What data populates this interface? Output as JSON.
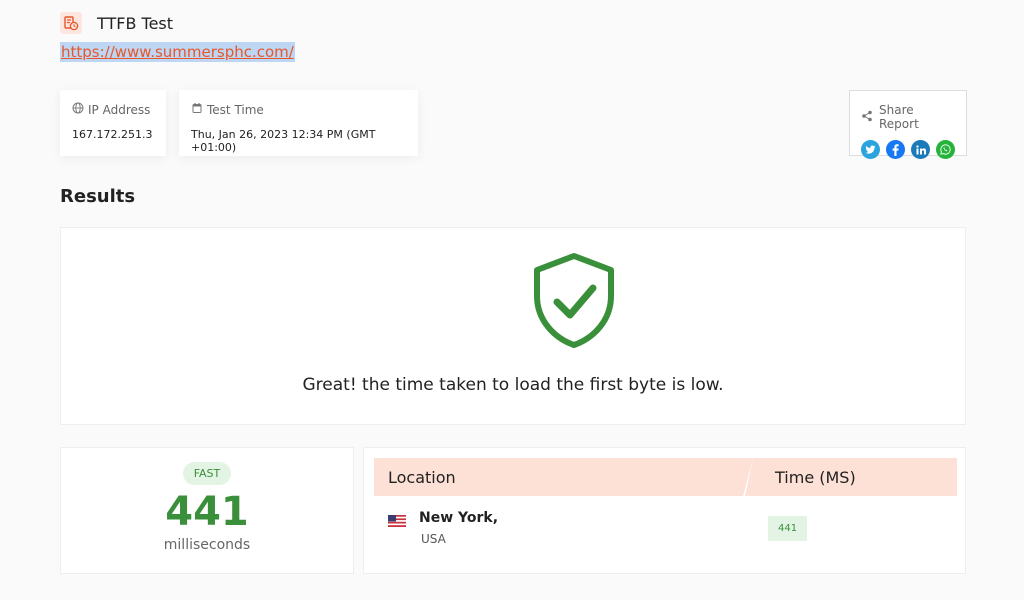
{
  "header": {
    "title": "TTFB Test",
    "icon": "report-clock-icon",
    "icon_color": "#e8562a"
  },
  "url": "https://www.summersphc.com/",
  "ip_card": {
    "label": "IP Address",
    "value": "167.172.251.3",
    "icon": "globe-icon"
  },
  "time_card": {
    "label": "Test Time",
    "value": "Thu, Jan 26, 2023 12:34 PM (GMT +01:00)",
    "icon": "calendar-icon"
  },
  "share": {
    "label": "Share Report",
    "icon": "share-icon",
    "socials": [
      {
        "name": "twitter",
        "color": "#2aa3df"
      },
      {
        "name": "facebook",
        "color": "#1877f2"
      },
      {
        "name": "linkedin",
        "color": "#1b7ab8"
      },
      {
        "name": "whatsapp",
        "color": "#25b33c"
      }
    ]
  },
  "results": {
    "title": "Results",
    "icon": "shield-check-icon",
    "message": "Great! the time taken to load the first byte is low.",
    "accent": "#3a8f3a"
  },
  "speed": {
    "badge": "FAST",
    "value": "441",
    "unit": "milliseconds"
  },
  "table": {
    "headers": [
      "Location",
      "Time (MS)"
    ],
    "rows": [
      {
        "city": "New York,",
        "country": "USA",
        "flag": "us-flag-icon",
        "time": "441"
      }
    ]
  }
}
